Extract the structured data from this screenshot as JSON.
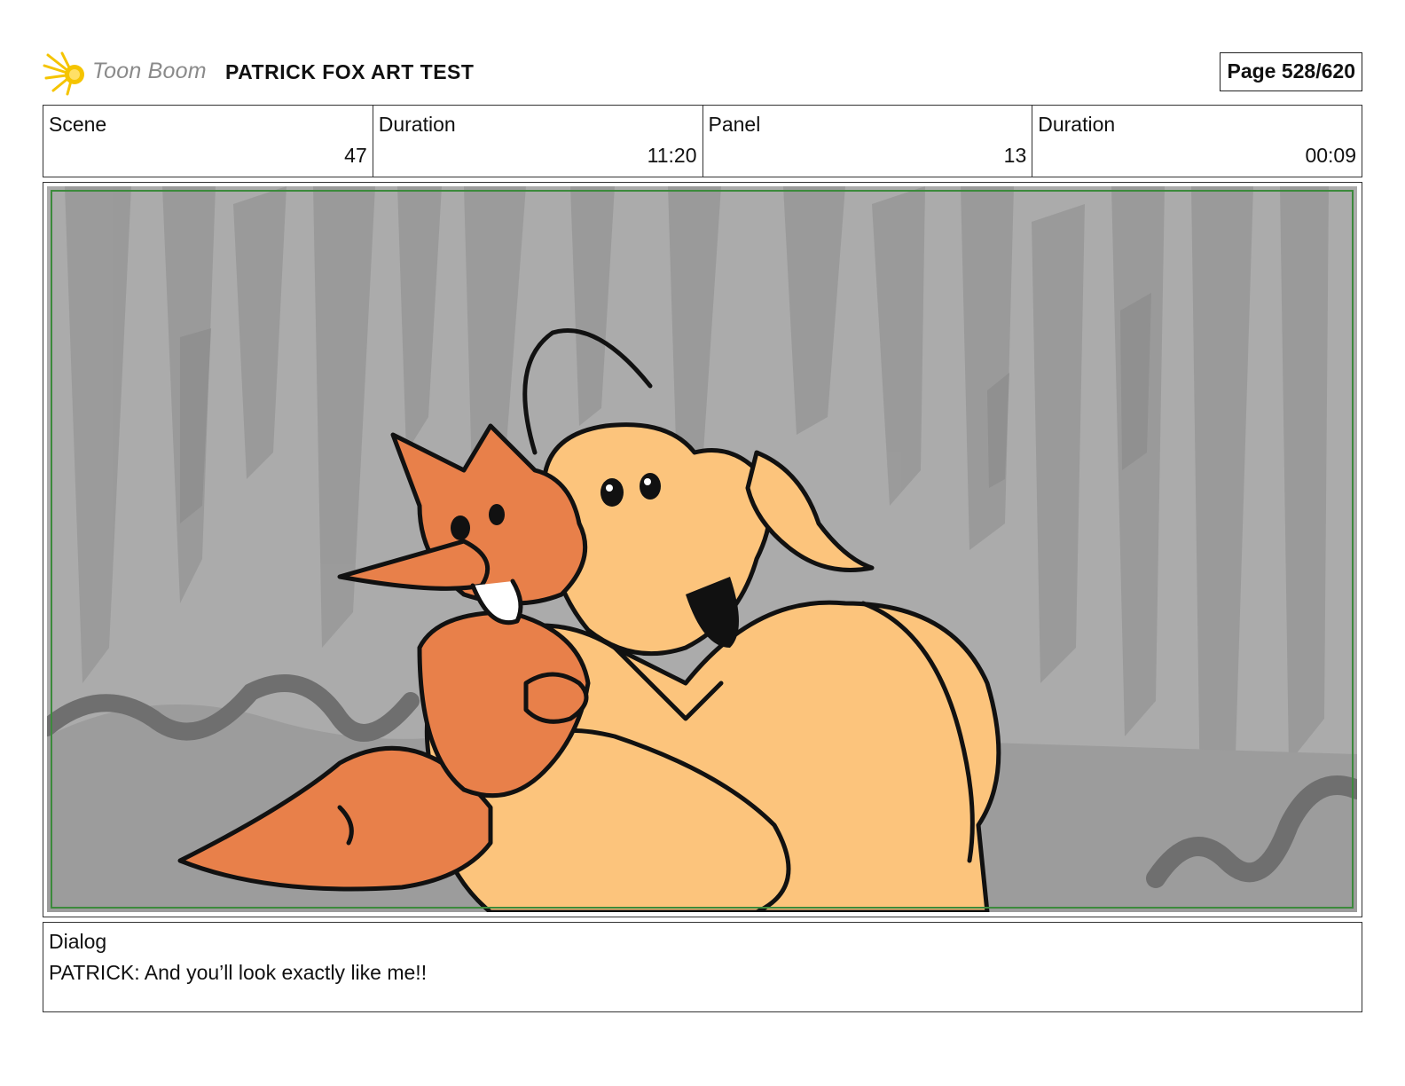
{
  "header": {
    "logo_text": "Toon Boom",
    "project_title": "PATRICK FOX ART TEST",
    "page_indicator": "Page 528/620"
  },
  "info": {
    "scene_label": "Scene",
    "scene_value": "47",
    "scene_duration_label": "Duration",
    "scene_duration_value": "11:20",
    "panel_label": "Panel",
    "panel_value": "13",
    "panel_duration_label": "Duration",
    "panel_duration_value": "00:09"
  },
  "dialog": {
    "label": "Dialog",
    "text": "PATRICK: And you’ll look exactly like me!!"
  },
  "colors": {
    "logo_accent": "#f5c400",
    "background_gray": "#a8a8a8",
    "fox_orange": "#e8804a",
    "character_peach": "#fcc47c",
    "safe_frame_green": "#3c8a3c"
  },
  "icons": {
    "logo": "toon-boom-starburst-logo"
  }
}
